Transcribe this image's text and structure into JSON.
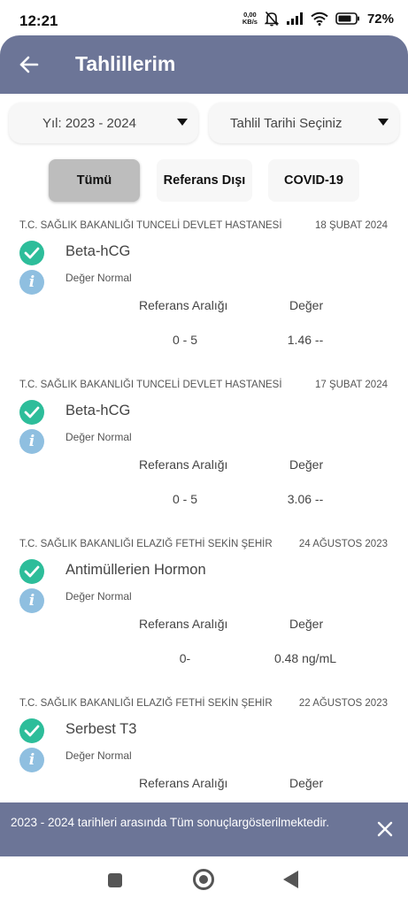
{
  "status_bar": {
    "time": "12:21",
    "net_speed_value": "0,00",
    "net_speed_unit": "KB/s",
    "battery": "72%",
    "icons": [
      "mute-bell-icon",
      "signal-icon",
      "wifi-icon",
      "battery-icon"
    ]
  },
  "header": {
    "title": "Tahlillerim",
    "back_icon": "arrow-left-icon"
  },
  "filters": {
    "year_label": "Yıl: 2023 - 2024",
    "date_label": "Tahlil Tarihi Seçiniz",
    "tabs": [
      "Tümü",
      "Referans Dışı",
      "COVID-19"
    ],
    "active_tab": "Tümü"
  },
  "results": [
    {
      "hospital": "T.C. SAĞLIK BAKANLIĞI TUNCELİ DEVLET HASTANESİ",
      "date": "18 ŞUBAT 2024",
      "test": "Beta-hCG",
      "status": "Değer Normal",
      "ref_header": "Referans Aralığı",
      "value_header": "Değer",
      "range": "0 - 5",
      "value": "1.46 --"
    },
    {
      "hospital": "T.C. SAĞLIK BAKANLIĞI TUNCELİ DEVLET HASTANESİ",
      "date": "17 ŞUBAT 2024",
      "test": "Beta-hCG",
      "status": "Değer Normal",
      "ref_header": "Referans Aralığı",
      "value_header": "Değer",
      "range": "0 - 5",
      "value": "3.06 --"
    },
    {
      "hospital": "T.C. SAĞLIK BAKANLIĞI ELAZIĞ FETHİ SEKİN ŞEHİR",
      "date": "24 AĞUSTOS 2023",
      "test": "Antimüllerien Hormon",
      "status": "Değer Normal",
      "ref_header": "Referans Aralığı",
      "value_header": "Değer",
      "range": "0-",
      "value": "0.48 ng/mL"
    },
    {
      "hospital": "T.C. SAĞLIK BAKANLIĞI ELAZIĞ FETHİ SEKİN ŞEHİR",
      "date": "22 AĞUSTOS 2023",
      "test": "Serbest T3",
      "status": "Değer Normal",
      "ref_header": "Referans Aralığı",
      "value_header": "Değer",
      "range": "",
      "value": ""
    }
  ],
  "snackbar": {
    "text": "2023 - 2024 tarihleri arasında Tüm sonuçlargösterilmektedir.",
    "close_icon": "close-icon"
  },
  "nav_bar": {
    "icons": [
      "recent-apps-icon",
      "home-icon",
      "back-icon"
    ]
  },
  "colors": {
    "app_bar": "#6c7597",
    "check_green": "#2dbd9a",
    "info_blue": "#8fbfe0",
    "active_tab": "#bdbdbd"
  }
}
